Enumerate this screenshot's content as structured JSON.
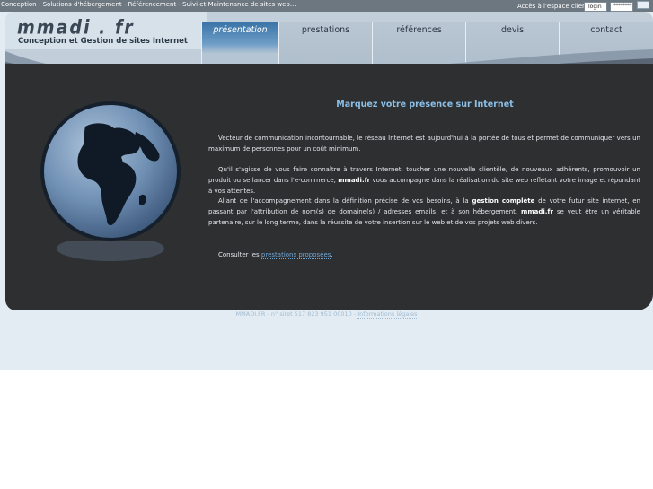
{
  "topbar": {
    "tagline": "Conception - Solutions d'hébergement - Référencement - Suivi et Maintenance de sites web...",
    "client_label": "Accès à l'espace client",
    "login_value": "login",
    "password_value": "********"
  },
  "logo": {
    "name": "mmadi . fr",
    "subtitle": "Conception et Gestion de sites Internet"
  },
  "nav": [
    {
      "label": "présentation",
      "active": true
    },
    {
      "label": "prestations",
      "active": false
    },
    {
      "label": "références",
      "active": false
    },
    {
      "label": "devis",
      "active": false
    },
    {
      "label": "contact",
      "active": false
    }
  ],
  "content": {
    "title": "Marquez votre présence sur Internet",
    "p1": "Vecteur de communication incontournable, le réseau Internet est aujourd'hui à la portée de tous et permet de communiquer vers un maximum de personnes pour un coût minimum.",
    "p2_a": "Qu'il s'agisse de vous faire connaître à travers Internet, toucher une nouvelle clientèle, de nouveaux adhérents, promouvoir un produit ou se lancer dans l'e-commerce, ",
    "p2_b": "mmadi.fr",
    "p2_c": " vous accompagne dans la réalisation du site web reflétant votre image et répondant à vos attentes.",
    "p3_a": "Allant de l'accompagnement dans la définition précise de vos besoins, à la ",
    "p3_b": "gestion complète",
    "p3_c": " de votre futur site internet, en passant par l'attribution de nom(s) de domaine(s) / adresses emails, et à son hébergement, ",
    "p3_d": "mmadi.fr",
    "p3_e": " se veut être un véritable partenaire, sur le long terme, dans la réussite de votre insertion sur le web et de vos projets web divers.",
    "consult_prefix": "Consulter les ",
    "consult_link": "prestations proposées",
    "consult_suffix": "."
  },
  "footer": {
    "text": "MMADI.FR - n° siret 517 823 951 00010 - ",
    "legal_link": "Informations légales"
  },
  "colors": {
    "accent": "#3a74a8",
    "title": "#8bbfe6",
    "panel": "#2e2f31"
  }
}
